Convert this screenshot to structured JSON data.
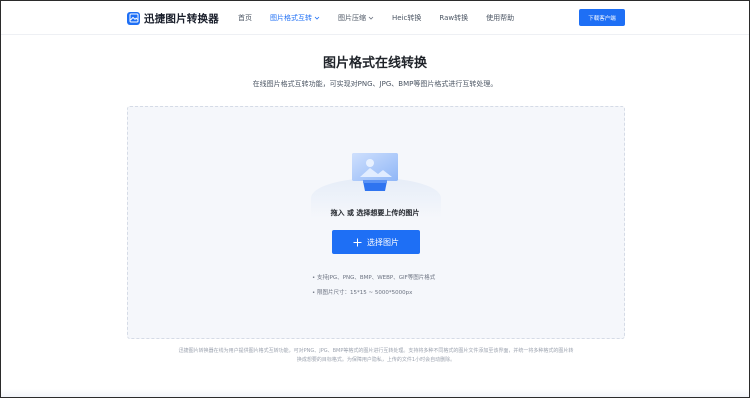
{
  "header": {
    "logo_text": "迅捷图片转换器",
    "menu": [
      {
        "label": "首页"
      },
      {
        "label": "图片格式互转"
      },
      {
        "label": "图片压缩"
      },
      {
        "label": "Heic转换"
      },
      {
        "label": "Raw转换"
      },
      {
        "label": "使用帮助"
      }
    ],
    "download_label": "下载客户端"
  },
  "hero": {
    "title": "图片格式在线转换",
    "subtitle": "在线图片格式互转功能，可实现对PNG、JPG、BMP等图片格式进行互转处理。"
  },
  "upload": {
    "drop_text": "拖入 或 选择想要上传的图片",
    "button_label": "选择图片",
    "requirements": [
      "• 支持JPG、PNG、BMP、WEBP、GIF等图片格式",
      "• 限图片尺寸：15*15 ~ 5000*5000px"
    ]
  },
  "footer_note": {
    "line1": "迅捷图片转换器在线为用户提供图片格式互转功能，可对PNG、JPG、BMP等格式的图片进行互转处理。支持将多种不同格式的图片文件添加至该界面，并统一将多种格式的图片转",
    "line2": "换成想要的目标格式。为保障用户隐私，上传的文件1小时会自动删除。"
  },
  "colors": {
    "accent": "#1e6ff5",
    "page_bg": "#ffffff",
    "upload_bg": "#f5f7fb"
  },
  "icons": {
    "logo": "image-logo-icon",
    "dropdown": "chevron-down-icon",
    "upload_illustration": "image-upload-illustration",
    "plus": "plus-icon"
  }
}
